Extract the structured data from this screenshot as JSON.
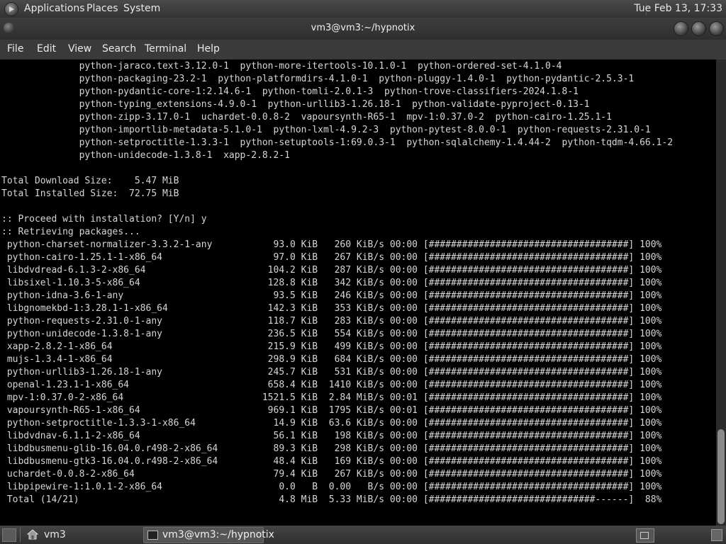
{
  "top_panel": {
    "menus": [
      "Applications",
      "Places",
      "System"
    ],
    "clock": "Tue Feb 13, 17:33"
  },
  "window": {
    "title": "vm3@vm3:~/hypnotix"
  },
  "menubar": [
    "File",
    "Edit",
    "View",
    "Search",
    "Terminal",
    "Help"
  ],
  "terminal": {
    "lines": [
      "              python-jaraco.text-3.12.0-1  python-more-itertools-10.1.0-1  python-ordered-set-4.1.0-4",
      "              python-packaging-23.2-1  python-platformdirs-4.1.0-1  python-pluggy-1.4.0-1  python-pydantic-2.5.3-1",
      "              python-pydantic-core-1:2.14.6-1  python-tomli-2.0.1-3  python-trove-classifiers-2024.1.8-1",
      "              python-typing_extensions-4.9.0-1  python-urllib3-1.26.18-1  python-validate-pyproject-0.13-1",
      "              python-zipp-3.17.0-1  uchardet-0.0.8-2  vapoursynth-R65-1  mpv-1:0.37.0-2  python-cairo-1.25.1-1",
      "              python-importlib-metadata-5.1.0-1  python-lxml-4.9.2-3  python-pytest-8.0.0-1  python-requests-2.31.0-1",
      "              python-setproctitle-1.3.3-1  python-setuptools-1:69.0.3-1  python-sqlalchemy-1.4.44-2  python-tqdm-4.66.1-2",
      "              python-unidecode-1.3.8-1  xapp-2.8.2-1",
      "",
      "Total Download Size:    5.47 MiB",
      "Total Installed Size:  72.75 MiB",
      "",
      ":: Proceed with installation? [Y/n] y",
      ":: Retrieving packages...",
      " python-charset-normalizer-3.3.2-1-any           93.0 KiB   260 KiB/s 00:00 [####################################] 100%",
      " python-cairo-1.25.1-1-x86_64                    97.0 KiB   267 KiB/s 00:00 [####################################] 100%",
      " libdvdread-6.1.3-2-x86_64                      104.2 KiB   287 KiB/s 00:00 [####################################] 100%",
      " libsixel-1.10.3-5-x86_64                       128.8 KiB   342 KiB/s 00:00 [####################################] 100%",
      " python-idna-3.6-1-any                           93.5 KiB   246 KiB/s 00:00 [####################################] 100%",
      " libgnomekbd-1:3.28.1-1-x86_64                  142.3 KiB   353 KiB/s 00:00 [####################################] 100%",
      " python-requests-2.31.0-1-any                   118.7 KiB   283 KiB/s 00:00 [####################################] 100%",
      " python-unidecode-1.3.8-1-any                   236.5 KiB   554 KiB/s 00:00 [####################################] 100%",
      " xapp-2.8.2-1-x86_64                            215.9 KiB   499 KiB/s 00:00 [####################################] 100%",
      " mujs-1.3.4-1-x86_64                            298.9 KiB   684 KiB/s 00:00 [####################################] 100%",
      " python-urllib3-1.26.18-1-any                   245.7 KiB   531 KiB/s 00:00 [####################################] 100%",
      " openal-1.23.1-1-x86_64                         658.4 KiB  1410 KiB/s 00:00 [####################################] 100%",
      " mpv-1:0.37.0-2-x86_64                         1521.5 KiB  2.84 MiB/s 00:01 [####################################] 100%",
      " vapoursynth-R65-1-x86_64                       969.1 KiB  1795 KiB/s 00:01 [####################################] 100%",
      " python-setproctitle-1.3.3-1-x86_64              14.9 KiB  63.6 KiB/s 00:00 [####################################] 100%",
      " libdvdnav-6.1.1-2-x86_64                        56.1 KiB   198 KiB/s 00:00 [####################################] 100%",
      " libdbusmenu-glib-16.04.0.r498-2-x86_64          89.3 KiB   298 KiB/s 00:00 [####################################] 100%",
      " libdbusmenu-gtk3-16.04.0.r498-2-x86_64          48.4 KiB   169 KiB/s 00:00 [####################################] 100%",
      " uchardet-0.0.8-2-x86_64                         79.4 KiB   267 KiB/s 00:00 [####################################] 100%",
      " libpipewire-1:1.0.1-2-x86_64                     0.0   B  0.00   B/s 00:00 [####################################] 100%",
      " Total (14/21)                                    4.8 MiB  5.33 MiB/s 00:00 [##############################------]  88%"
    ]
  },
  "bottom_panel": {
    "folder_label": "vm3",
    "task_label": "vm3@vm3:~/hypnotix"
  }
}
